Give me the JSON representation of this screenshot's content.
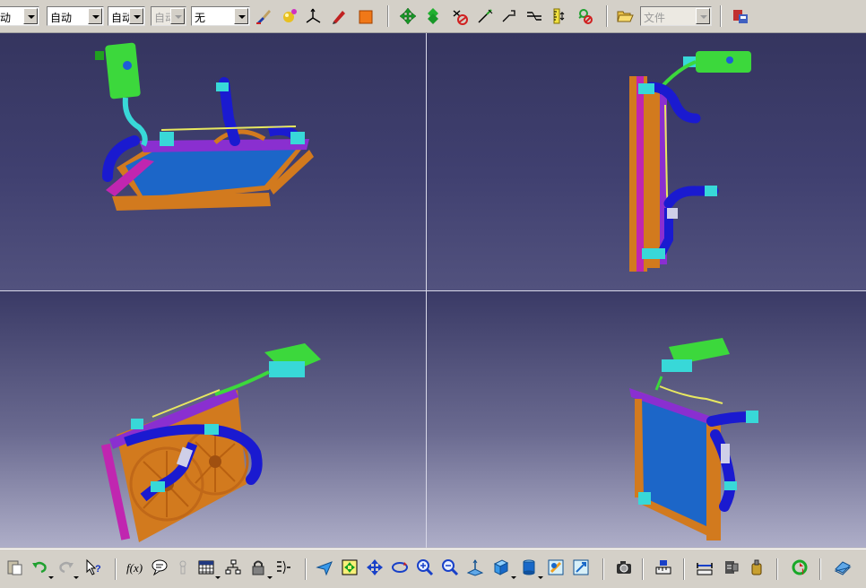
{
  "toolbar_top": {
    "combos": [
      {
        "id": "combo-1",
        "value": "动",
        "disabled": false
      },
      {
        "id": "combo-2",
        "value": "自动",
        "disabled": false
      },
      {
        "id": "combo-3",
        "value": "自动",
        "disabled": false
      },
      {
        "id": "combo-4",
        "value": "自动",
        "disabled": true
      },
      {
        "id": "combo-5",
        "value": "无",
        "disabled": false
      }
    ],
    "file_combo": {
      "value": "文件",
      "disabled": true
    },
    "icons": [
      "paint-brush-icon",
      "sphere-material-icon",
      "axis-system-icon",
      "pen-marker-icon",
      "orange-cube-icon",
      "pan-icon",
      "rotate-icon",
      "no-show-icon",
      "compass-icon",
      "snap-icon",
      "align-icon",
      "ruler-icon",
      "swap-visible-icon",
      "open-folder-icon",
      "catalog-icon"
    ]
  },
  "viewports": [
    {
      "id": "top-left",
      "view": "isometric"
    },
    {
      "id": "top-right",
      "view": "side"
    },
    {
      "id": "bottom-left",
      "view": "rear-fan"
    },
    {
      "id": "bottom-right",
      "view": "front"
    }
  ],
  "toolbar_bottom": {
    "icons": [
      "paste-special-icon",
      "undo-icon",
      "redo-icon",
      "whats-this-icon",
      "formula-icon",
      "comment-icon",
      "knowledge-icon",
      "table-icon",
      "tree-icon",
      "lock-icon",
      "parameters-icon",
      "fly-mode-icon",
      "fit-all-icon",
      "pan-view-icon",
      "rotate-view-icon",
      "zoom-in-icon",
      "zoom-out-icon",
      "normal-view-icon",
      "iso-view-icon",
      "render-style-icon",
      "hide-show-icon",
      "swap-space-icon",
      "capture-icon",
      "measure-icon",
      "measure-between-icon",
      "measure-item-icon",
      "inertia-icon",
      "update-icon",
      "sketch-plane-icon"
    ]
  },
  "colors": {
    "background": "#d4d0c8",
    "viewport_top": "#35355f",
    "viewport_bottom": "#aeaec8",
    "hose": "#1a1ad0",
    "tank": "#3cd83c",
    "fan": "#d27a1e",
    "frame": "#8a2fd0",
    "core": "#1c66c8",
    "clamp": "#38d8d8"
  }
}
